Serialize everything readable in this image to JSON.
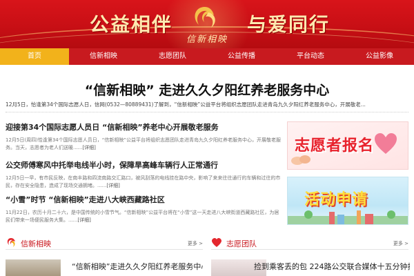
{
  "banner": {
    "slogan_left": "公益相伴",
    "slogan_right": "与爱同行",
    "logo_text": "信新相映"
  },
  "nav": {
    "items": [
      "首页",
      "信新相映",
      "志愿团队",
      "公益传播",
      "平台动态",
      "公益影像"
    ],
    "active_index": 0
  },
  "headline": {
    "title": "“信新相映” 走进久久夕阳红养老服务中心",
    "lead": "12月5日，恰逢第34个国际志愿人日，信网(0532—80889431)了解到，“信新相映”公益平台将组织志愿团队走进青岛九久夕阳红养老服务中心，开展敬老..."
  },
  "news": [
    {
      "title": "迎接第34个国际志愿人员日 “信新相映”养老中心开展敬老服务",
      "summary": "12月5日(周四)恰逢第34个国际志愿人员日，“信新相映”公益平台将组织志愿团队走进青岛九久夕阳红养老服务中心，开展敬老服务。当天，志愿者为老人们送暖......",
      "more": "[详细]"
    },
    {
      "title": "公交师傅寒风中托举电线半小时，保障旱高峰车辆行人正常通行",
      "summary": "12月5日一早，有市民反映，在南丰路和四流南路交汇路口，被风刮落的电线挂在路中央，影响了来来往往通行的车辆和过往的市民，存在安全隐患，造成了现场交通拥堵。......",
      "more": "[详细]"
    },
    {
      "title": "“小雪”时节 “信新相映”走进八大峡西藏路社区",
      "summary": "11月22日，农历十月二十六，是中国传统的小雪节气。“信新相映”公益平台将在“小雪”这一天走进八大峡街道西藏路社区，为居民们带来一场便民服务大集。......",
      "more": "[详细]"
    }
  ],
  "ads": {
    "ad1_label": "志愿者报名",
    "ad2_label": "活动申请"
  },
  "sections": {
    "left_title": "信新相映",
    "right_title": "志愿团队",
    "more_label": "更多 >"
  },
  "bottom": {
    "left_teaser": "“信新相映”走进久久夕阳红养老服务中心",
    "right_teaser": "捡到乘客丢的包 224路公交联合媒体十五分钟找到失主"
  },
  "colors": {
    "brand_red": "#c8161d",
    "nav_active": "#f2b21b",
    "banner_red": "#d8141a"
  }
}
